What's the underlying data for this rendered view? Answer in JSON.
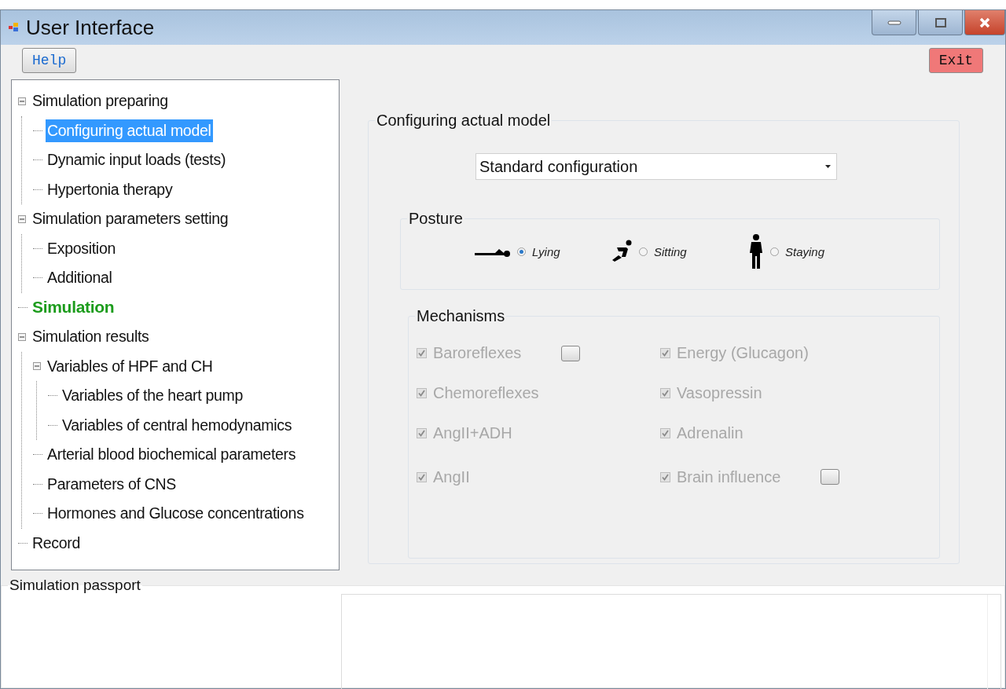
{
  "window": {
    "title": "User Interface"
  },
  "toolbar": {
    "help": "Help",
    "exit": "Exit"
  },
  "tree": [
    {
      "label": "Simulation preparing",
      "highlighted": false,
      "selected": false,
      "expanded": true,
      "children": [
        {
          "label": "Configuring actual model",
          "highlighted": false,
          "selected": true
        },
        {
          "label": "Dynamic input loads (tests)",
          "highlighted": false,
          "selected": false
        },
        {
          "label": "Hypertonia therapy",
          "highlighted": false,
          "selected": false
        }
      ]
    },
    {
      "label": "Simulation parameters setting",
      "highlighted": false,
      "selected": false,
      "expanded": true,
      "children": [
        {
          "label": "Exposition",
          "highlighted": false,
          "selected": false
        },
        {
          "label": "Additional",
          "highlighted": false,
          "selected": false
        }
      ]
    },
    {
      "label": "Simulation",
      "highlighted": true,
      "selected": false
    },
    {
      "label": "Simulation results",
      "highlighted": false,
      "selected": false,
      "expanded": true,
      "children": [
        {
          "label": "Variables of HPF and CH",
          "highlighted": false,
          "selected": false,
          "expanded": true,
          "children": [
            {
              "label": "Variables of the heart pump",
              "highlighted": false,
              "selected": false
            },
            {
              "label": "Variables of central hemodynamics",
              "highlighted": false,
              "selected": false
            }
          ]
        },
        {
          "label": "Arterial blood biochemical parameters",
          "highlighted": false,
          "selected": false
        },
        {
          "label": "Parameters of CNS",
          "highlighted": false,
          "selected": false
        },
        {
          "label": "Hormones and Glucose concentrations",
          "highlighted": false,
          "selected": false
        }
      ]
    },
    {
      "label": "Record",
      "highlighted": false,
      "selected": false
    }
  ],
  "config": {
    "title": "Configuring actual model",
    "dropdown": {
      "value": "Standard configuration"
    },
    "posture": {
      "title": "Posture",
      "options": [
        {
          "label": "Lying",
          "kind": "lying",
          "selected": true
        },
        {
          "label": "Sitting",
          "kind": "sitting",
          "selected": false
        },
        {
          "label": "Staying",
          "kind": "standing",
          "selected": false
        }
      ]
    },
    "mechanisms": {
      "title": "Mechanisms",
      "items": [
        {
          "label": "Baroreflexes",
          "checked": true,
          "disabled": true,
          "kind": "with_button"
        },
        {
          "label": "Energy (Glucagon)",
          "checked": true,
          "disabled": true,
          "kind": "plain"
        },
        {
          "label": "Chemoreflexes",
          "checked": true,
          "disabled": true,
          "kind": "plain"
        },
        {
          "label": "Vasopressin",
          "checked": true,
          "disabled": true,
          "kind": "plain"
        },
        {
          "label": "AngII+ADH",
          "checked": true,
          "disabled": true,
          "kind": "plain"
        },
        {
          "label": "Adrenalin",
          "checked": true,
          "disabled": true,
          "kind": "plain"
        },
        {
          "label": "AngII",
          "checked": true,
          "disabled": true,
          "kind": "plain"
        },
        {
          "label": "Brain influence",
          "checked": true,
          "disabled": true,
          "kind": "with_button"
        }
      ]
    }
  },
  "passport": {
    "title": "Simulation passport"
  }
}
